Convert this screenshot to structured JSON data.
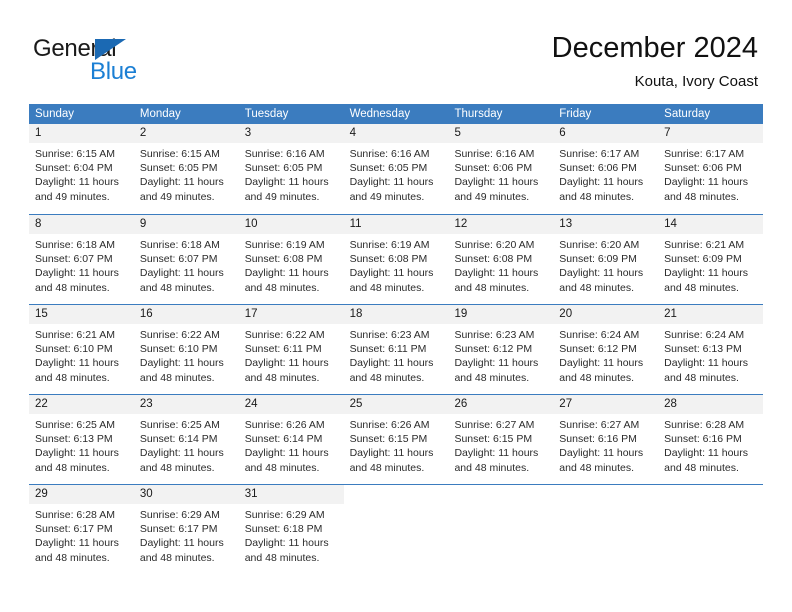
{
  "logo": {
    "word_one": "General",
    "word_two": "Blue",
    "triangle_color": "#1b69b3",
    "blue_text_color": "#1b7fd4"
  },
  "header": {
    "title": "December 2024",
    "subtitle": "Kouta, Ivory Coast"
  },
  "theme": {
    "header_blue": "#3b7cbf",
    "daynum_gray": "#f2f2f2",
    "text_color": "#2b2b2b"
  },
  "weekdays": [
    "Sunday",
    "Monday",
    "Tuesday",
    "Wednesday",
    "Thursday",
    "Friday",
    "Saturday"
  ],
  "weeks": [
    [
      {
        "day": "1",
        "sunrise": "Sunrise: 6:15 AM",
        "sunset": "Sunset: 6:04 PM",
        "daylight_line1": "Daylight: 11 hours",
        "daylight_line2": "and 49 minutes."
      },
      {
        "day": "2",
        "sunrise": "Sunrise: 6:15 AM",
        "sunset": "Sunset: 6:05 PM",
        "daylight_line1": "Daylight: 11 hours",
        "daylight_line2": "and 49 minutes."
      },
      {
        "day": "3",
        "sunrise": "Sunrise: 6:16 AM",
        "sunset": "Sunset: 6:05 PM",
        "daylight_line1": "Daylight: 11 hours",
        "daylight_line2": "and 49 minutes."
      },
      {
        "day": "4",
        "sunrise": "Sunrise: 6:16 AM",
        "sunset": "Sunset: 6:05 PM",
        "daylight_line1": "Daylight: 11 hours",
        "daylight_line2": "and 49 minutes."
      },
      {
        "day": "5",
        "sunrise": "Sunrise: 6:16 AM",
        "sunset": "Sunset: 6:06 PM",
        "daylight_line1": "Daylight: 11 hours",
        "daylight_line2": "and 49 minutes."
      },
      {
        "day": "6",
        "sunrise": "Sunrise: 6:17 AM",
        "sunset": "Sunset: 6:06 PM",
        "daylight_line1": "Daylight: 11 hours",
        "daylight_line2": "and 48 minutes."
      },
      {
        "day": "7",
        "sunrise": "Sunrise: 6:17 AM",
        "sunset": "Sunset: 6:06 PM",
        "daylight_line1": "Daylight: 11 hours",
        "daylight_line2": "and 48 minutes."
      }
    ],
    [
      {
        "day": "8",
        "sunrise": "Sunrise: 6:18 AM",
        "sunset": "Sunset: 6:07 PM",
        "daylight_line1": "Daylight: 11 hours",
        "daylight_line2": "and 48 minutes."
      },
      {
        "day": "9",
        "sunrise": "Sunrise: 6:18 AM",
        "sunset": "Sunset: 6:07 PM",
        "daylight_line1": "Daylight: 11 hours",
        "daylight_line2": "and 48 minutes."
      },
      {
        "day": "10",
        "sunrise": "Sunrise: 6:19 AM",
        "sunset": "Sunset: 6:08 PM",
        "daylight_line1": "Daylight: 11 hours",
        "daylight_line2": "and 48 minutes."
      },
      {
        "day": "11",
        "sunrise": "Sunrise: 6:19 AM",
        "sunset": "Sunset: 6:08 PM",
        "daylight_line1": "Daylight: 11 hours",
        "daylight_line2": "and 48 minutes."
      },
      {
        "day": "12",
        "sunrise": "Sunrise: 6:20 AM",
        "sunset": "Sunset: 6:08 PM",
        "daylight_line1": "Daylight: 11 hours",
        "daylight_line2": "and 48 minutes."
      },
      {
        "day": "13",
        "sunrise": "Sunrise: 6:20 AM",
        "sunset": "Sunset: 6:09 PM",
        "daylight_line1": "Daylight: 11 hours",
        "daylight_line2": "and 48 minutes."
      },
      {
        "day": "14",
        "sunrise": "Sunrise: 6:21 AM",
        "sunset": "Sunset: 6:09 PM",
        "daylight_line1": "Daylight: 11 hours",
        "daylight_line2": "and 48 minutes."
      }
    ],
    [
      {
        "day": "15",
        "sunrise": "Sunrise: 6:21 AM",
        "sunset": "Sunset: 6:10 PM",
        "daylight_line1": "Daylight: 11 hours",
        "daylight_line2": "and 48 minutes."
      },
      {
        "day": "16",
        "sunrise": "Sunrise: 6:22 AM",
        "sunset": "Sunset: 6:10 PM",
        "daylight_line1": "Daylight: 11 hours",
        "daylight_line2": "and 48 minutes."
      },
      {
        "day": "17",
        "sunrise": "Sunrise: 6:22 AM",
        "sunset": "Sunset: 6:11 PM",
        "daylight_line1": "Daylight: 11 hours",
        "daylight_line2": "and 48 minutes."
      },
      {
        "day": "18",
        "sunrise": "Sunrise: 6:23 AM",
        "sunset": "Sunset: 6:11 PM",
        "daylight_line1": "Daylight: 11 hours",
        "daylight_line2": "and 48 minutes."
      },
      {
        "day": "19",
        "sunrise": "Sunrise: 6:23 AM",
        "sunset": "Sunset: 6:12 PM",
        "daylight_line1": "Daylight: 11 hours",
        "daylight_line2": "and 48 minutes."
      },
      {
        "day": "20",
        "sunrise": "Sunrise: 6:24 AM",
        "sunset": "Sunset: 6:12 PM",
        "daylight_line1": "Daylight: 11 hours",
        "daylight_line2": "and 48 minutes."
      },
      {
        "day": "21",
        "sunrise": "Sunrise: 6:24 AM",
        "sunset": "Sunset: 6:13 PM",
        "daylight_line1": "Daylight: 11 hours",
        "daylight_line2": "and 48 minutes."
      }
    ],
    [
      {
        "day": "22",
        "sunrise": "Sunrise: 6:25 AM",
        "sunset": "Sunset: 6:13 PM",
        "daylight_line1": "Daylight: 11 hours",
        "daylight_line2": "and 48 minutes."
      },
      {
        "day": "23",
        "sunrise": "Sunrise: 6:25 AM",
        "sunset": "Sunset: 6:14 PM",
        "daylight_line1": "Daylight: 11 hours",
        "daylight_line2": "and 48 minutes."
      },
      {
        "day": "24",
        "sunrise": "Sunrise: 6:26 AM",
        "sunset": "Sunset: 6:14 PM",
        "daylight_line1": "Daylight: 11 hours",
        "daylight_line2": "and 48 minutes."
      },
      {
        "day": "25",
        "sunrise": "Sunrise: 6:26 AM",
        "sunset": "Sunset: 6:15 PM",
        "daylight_line1": "Daylight: 11 hours",
        "daylight_line2": "and 48 minutes."
      },
      {
        "day": "26",
        "sunrise": "Sunrise: 6:27 AM",
        "sunset": "Sunset: 6:15 PM",
        "daylight_line1": "Daylight: 11 hours",
        "daylight_line2": "and 48 minutes."
      },
      {
        "day": "27",
        "sunrise": "Sunrise: 6:27 AM",
        "sunset": "Sunset: 6:16 PM",
        "daylight_line1": "Daylight: 11 hours",
        "daylight_line2": "and 48 minutes."
      },
      {
        "day": "28",
        "sunrise": "Sunrise: 6:28 AM",
        "sunset": "Sunset: 6:16 PM",
        "daylight_line1": "Daylight: 11 hours",
        "daylight_line2": "and 48 minutes."
      }
    ],
    [
      {
        "day": "29",
        "sunrise": "Sunrise: 6:28 AM",
        "sunset": "Sunset: 6:17 PM",
        "daylight_line1": "Daylight: 11 hours",
        "daylight_line2": "and 48 minutes."
      },
      {
        "day": "30",
        "sunrise": "Sunrise: 6:29 AM",
        "sunset": "Sunset: 6:17 PM",
        "daylight_line1": "Daylight: 11 hours",
        "daylight_line2": "and 48 minutes."
      },
      {
        "day": "31",
        "sunrise": "Sunrise: 6:29 AM",
        "sunset": "Sunset: 6:18 PM",
        "daylight_line1": "Daylight: 11 hours",
        "daylight_line2": "and 48 minutes."
      },
      {
        "day": "",
        "sunrise": "",
        "sunset": "",
        "daylight_line1": "",
        "daylight_line2": ""
      },
      {
        "day": "",
        "sunrise": "",
        "sunset": "",
        "daylight_line1": "",
        "daylight_line2": ""
      },
      {
        "day": "",
        "sunrise": "",
        "sunset": "",
        "daylight_line1": "",
        "daylight_line2": ""
      },
      {
        "day": "",
        "sunrise": "",
        "sunset": "",
        "daylight_line1": "",
        "daylight_line2": ""
      }
    ]
  ]
}
